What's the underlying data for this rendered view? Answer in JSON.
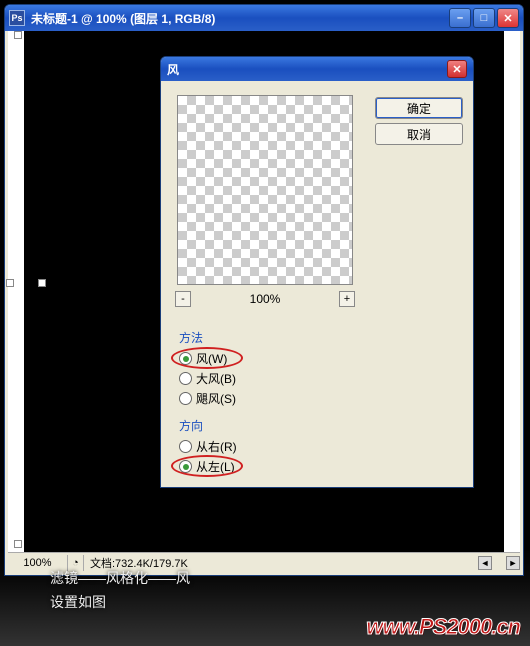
{
  "ps_window": {
    "title": "未标题-1 @ 100% (图层 1, RGB/8)",
    "status_zoom": "100%",
    "status_doc": "文档:732.4K/179.7K"
  },
  "dialog": {
    "title": "风",
    "buttons": {
      "ok": "确定",
      "cancel": "取消"
    },
    "preview_zoom": "100%",
    "zoom_out": "-",
    "zoom_in": "+",
    "method": {
      "label": "方法",
      "options": [
        {
          "label": "风(W)",
          "name": "radio-method-wind",
          "checked": true,
          "highlight": true
        },
        {
          "label": "大风(B)",
          "name": "radio-method-blast",
          "checked": false,
          "highlight": false
        },
        {
          "label": "飓风(S)",
          "name": "radio-method-stagger",
          "checked": false,
          "highlight": false
        }
      ]
    },
    "direction": {
      "label": "方向",
      "options": [
        {
          "label": "从右(R)",
          "name": "radio-dir-right",
          "checked": false,
          "highlight": false
        },
        {
          "label": "从左(L)",
          "name": "radio-dir-left",
          "checked": true,
          "highlight": true
        }
      ]
    }
  },
  "caption": {
    "line1": "滤镜——风格化——风",
    "line2": "设置如图"
  },
  "watermark": "www.PS2000.cn"
}
